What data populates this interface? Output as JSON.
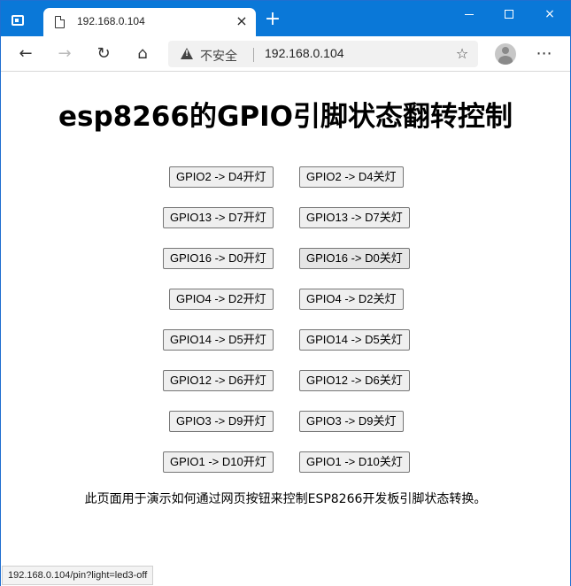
{
  "browser": {
    "tab_title": "192.168.0.104",
    "security_label": "不安全",
    "url": "192.168.0.104",
    "status_url": "192.168.0.104/pin?light=led3-off"
  },
  "icons": {
    "window": "window-icon",
    "page": "page-icon",
    "close": "×",
    "new_tab": "+",
    "back": "←",
    "forward": "→",
    "reload": "↻",
    "home": "⌂",
    "favorite": "☆",
    "menu": "⋯"
  },
  "page": {
    "title": "esp8266的GPIO引脚状态翻转控制",
    "description": "此页面用于演示如何通过网页按钮来控制ESP8266开发板引脚状态转换。",
    "buttons": [
      {
        "on": "GPIO2 -> D4开灯",
        "off": "GPIO2 -> D4关灯"
      },
      {
        "on": "GPIO13 -> D7开灯",
        "off": "GPIO13 -> D7关灯"
      },
      {
        "on": "GPIO16 -> D0开灯",
        "off": "GPIO16 -> D0关灯"
      },
      {
        "on": "GPIO4 -> D2开灯",
        "off": "GPIO4 -> D2关灯"
      },
      {
        "on": "GPIO14 -> D5开灯",
        "off": "GPIO14 -> D5关灯"
      },
      {
        "on": "GPIO12 -> D6开灯",
        "off": "GPIO12 -> D6关灯"
      },
      {
        "on": "GPIO3 -> D9开灯",
        "off": "GPIO3 -> D9关灯"
      },
      {
        "on": "GPIO1 -> D10开灯",
        "off": "GPIO1 -> D10关灯"
      }
    ]
  },
  "colors": {
    "titlebar": "#0a78d8",
    "button_bg": "#efefef",
    "button_border": "#767676"
  }
}
